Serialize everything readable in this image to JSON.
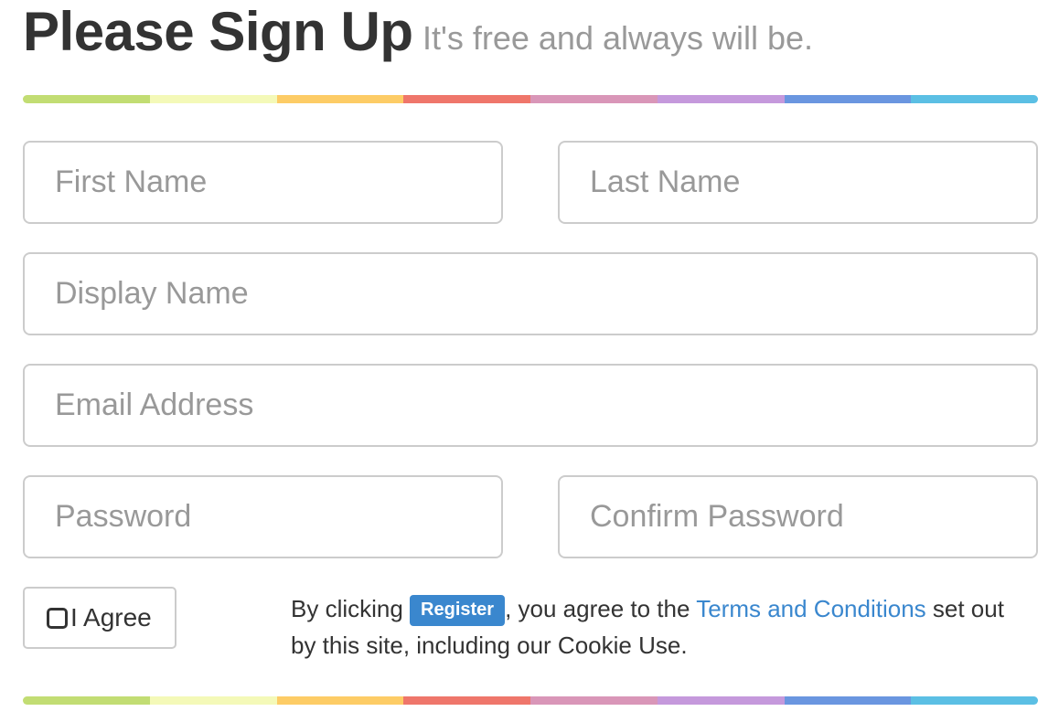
{
  "header": {
    "title": "Please Sign Up",
    "subtitle": "It's free and always will be."
  },
  "divider_colors": [
    "#c2dd73",
    "#f4f9b8",
    "#fdcc66",
    "#ef766b",
    "#d996b8",
    "#c599dc",
    "#6a96e0",
    "#5bbfe4"
  ],
  "form": {
    "first_name_placeholder": "First Name",
    "last_name_placeholder": "Last Name",
    "display_name_placeholder": "Display Name",
    "email_placeholder": "Email Address",
    "password_placeholder": "Password",
    "confirm_password_placeholder": "Confirm Password",
    "agree_label": "I Agree",
    "agree_checked": false
  },
  "terms": {
    "prefix": "By clicking ",
    "register_label": "Register",
    "middle": ", you agree to the ",
    "link_text": "Terms and Conditions",
    "suffix": " set out by this site, including our Cookie Use."
  },
  "colors": {
    "accent": "#3a87ce",
    "muted_text": "#999999",
    "border": "#cccccc"
  }
}
